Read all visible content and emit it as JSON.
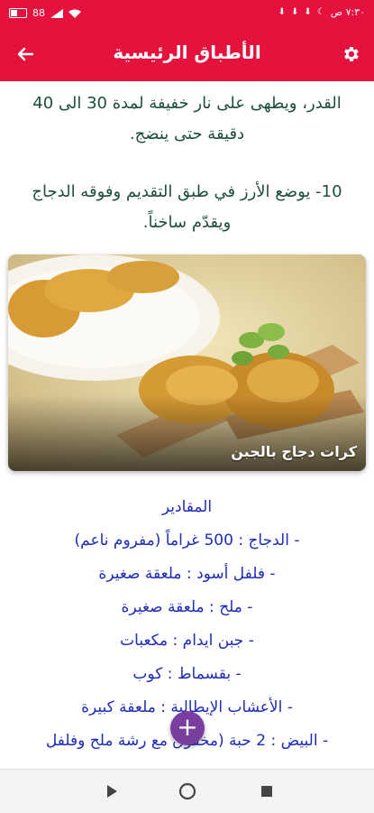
{
  "status_bar": {
    "battery": "88",
    "time": "٧:٣٠ ص"
  },
  "app_bar": {
    "title": "الأطباق الرئيسية"
  },
  "steps": [
    "القدر، ويطهى على نار خفيفة لمدة 30 الى 40 دقيقة حتى ينضج.",
    "10- يوضع الأرز في طبق التقديم وفوقه الدجاج ويقدّم ساخناً."
  ],
  "dish": {
    "caption": "كرات دجاج بالجبن"
  },
  "ingredients": {
    "heading": "المقادير",
    "items": [
      "- الدجاج : 500 غراماً (مفروم ناعم)",
      "- فلفل أسود : ملعقة صغيرة",
      "- ملح : ملعقة صغيرة",
      "- جبن ايدام : مكعبات",
      "- بقسماط : كوب",
      "- الأعشاب الإيطالية : ملعقة كبيرة",
      "- البيض : 2 حبة (مخفوق مع رشة ملح وفلفل"
    ]
  },
  "fab": {
    "label": "+"
  },
  "colors": {
    "primary": "#e5123d",
    "step_text": "#1d4f3a",
    "ingredient_text": "#1e2cb8",
    "fab": "#7a3ea1"
  },
  "icons": {
    "back": "arrow-left-icon",
    "settings": "gear-icon",
    "nav_back": "triangle-play-icon",
    "nav_home": "circle-icon",
    "nav_recents": "square-icon"
  }
}
